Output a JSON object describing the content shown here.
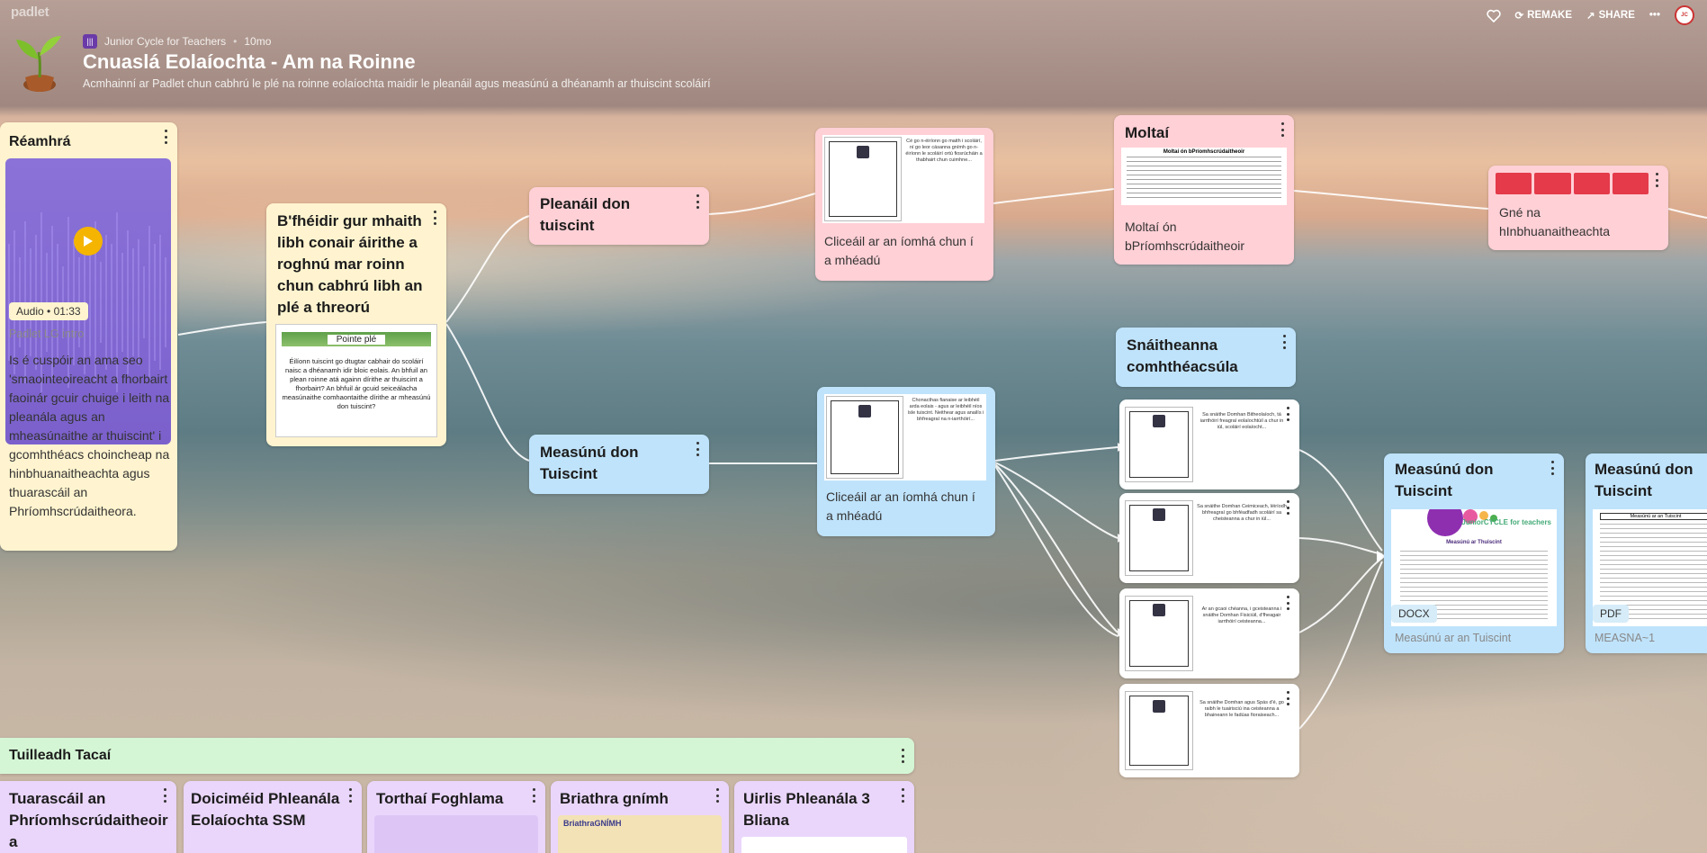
{
  "app": {
    "brand": "padlet"
  },
  "header": {
    "owner": "Junior Cycle for Teachers",
    "age": "10mo",
    "title": "Cnuaslá Eolaíochta - Am na Roinne",
    "subtitle": "Acmhainní ar Padlet chun cabhrú le plé na roinne eolaíochta maidir le pleanáil agus measúnú a dhéanamh ar thuiscint scoláirí",
    "actions": {
      "remake": "REMAKE",
      "share": "SHARE"
    }
  },
  "cards": {
    "reamhra": {
      "title": "Réamhrá",
      "audio_label": "Audio",
      "audio_duration": "01:33",
      "audio_name": "Padlet LG intro",
      "body": "Is é cuspóir an ama seo 'smaointeoireacht a fhorbairt faoinár gcuir chuige i leith na pleanála agus an mheasúnaithe ar thuiscint' i gcomhthéacs choincheap na hinbhuanaitheachta agus thuarascáil an Phríomhscrúdaitheora."
    },
    "bfheidir": {
      "title": "B'fhéidir gur mhaith libh conair áirithe a roghnú mar roinn chun cabhrú libh an plé a threorú",
      "thumb_heading": "Pointe plé",
      "thumb_text": "Éilíonn tuiscint go dtugtar cabhair do scoláirí naisc a dhéanamh idir bloic eolais. An bhfuil an plean roinne atá againn dírithe ar thuiscint a fhorbairt? An bhfuil ár gcuid seiceálacha measúnaithe comhaontaithe dírithe ar mheasúnú don tuiscint?"
    },
    "pleanail": {
      "title": "Pleanáil don tuiscint"
    },
    "measunu1": {
      "title": "Measúnú don Tuiscint"
    },
    "clic1": {
      "caption": "Cliceáil ar an íomhá chun í a mhéadú",
      "doc_text": "Cé go n-éiríonn go maith i scoláirí, ní go leor cásanna gnímh go n-éiríonn le scoláirí ortú fiosrúcháin a thabhairt chun cuimhne..."
    },
    "clic2": {
      "caption": "Cliceáil ar an íomhá chun í a mhéadú",
      "doc_text": "Chonacthas fianaise ar leibhéil arda eolais - agus ar leibhéil níos ísle tuiscint. Neithear agus anailís i bhfreagraí na n-iarrthóirí..."
    },
    "moltai": {
      "title": "Moltaí",
      "doc_heading": "Moltaí ón bPríomhscrúdaitheoir",
      "caption": "Moltaí ón bPríomhscrúdaitheoir"
    },
    "gne": {
      "caption": "Gné na hInbhuanaitheachta"
    },
    "snaitheanna": {
      "title": "Snáitheanna comhthéacsúla"
    },
    "snaith_docs": [
      {
        "text": "Sa snáithe Domhan Bitheolaíoch, tá iarrthóirí freagraí eolaíochtúil a chur in iúl, scoláirí eolaíocht..."
      },
      {
        "text": "Sa snáithe Domhan Ceimiceach, léiríodh bhfreagraí go bhféadfadh scoláirí sa cheisteanna a chur in iúl..."
      },
      {
        "text": "Ar an gcaoi chéanna, i gceisteanna i snáithe Domhan Fisiciúil, d'fheagair iarrthóirí ceisteanna..."
      },
      {
        "text": "Sa snáithe Domhan agus Spás d'é, go raibh le tuairisciú ina ceisteanna a bhaineann le fadúas fioraiseach..."
      }
    ],
    "docx": {
      "title": "Measúnú don Tuiscint",
      "ftype": "DOCX",
      "caption": "Measúnú ar an Tuiscint",
      "doc_title": "Measúnú ar Thuiscint",
      "brand": "JuniorCYCLE for teachers"
    },
    "pdf": {
      "title": "Measúnú don Tuiscint",
      "ftype": "PDF",
      "caption": "MEASNA~1",
      "doc_title": "Measúnú ar an Tuiscint"
    },
    "tuilleadh": {
      "title": "Tuilleadh Tacaí"
    },
    "bottom": [
      {
        "title": "Tuarascáil an Phríomhscrúdaitheoir a"
      },
      {
        "title": "Doiciméid Phleanála Eolaíochta SSM"
      },
      {
        "title": "Torthaí Foghlama"
      },
      {
        "title": "Briathra gnímh"
      },
      {
        "title": "Uirlis Phleanála 3 Bliana"
      }
    ],
    "briathra_thumb": "BriathraGNÍMH"
  }
}
